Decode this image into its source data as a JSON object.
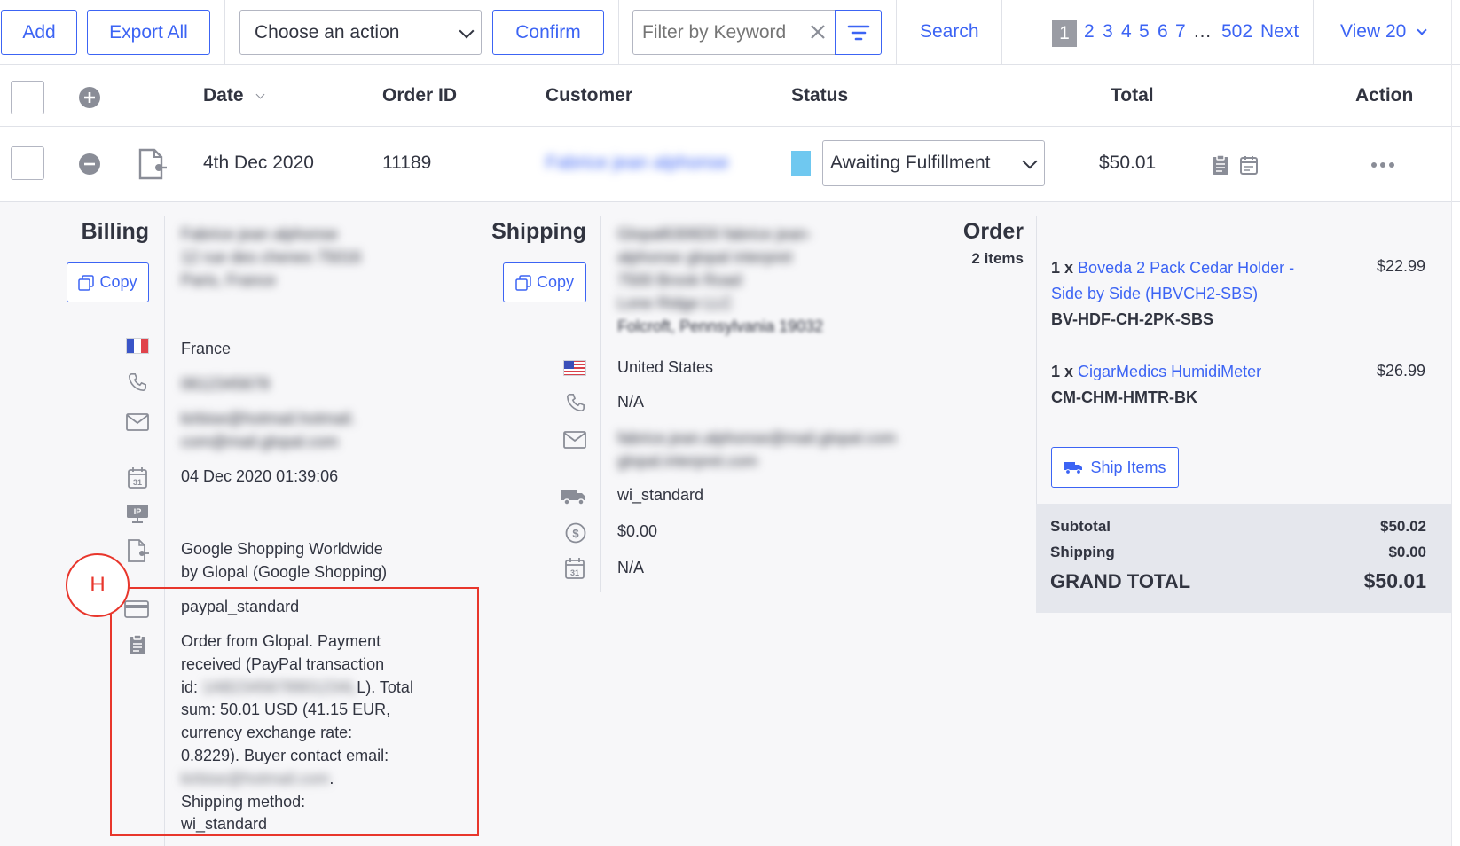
{
  "toolbar": {
    "add_label": "Add",
    "export_label": "Export All",
    "action_select": "Choose an action",
    "confirm_label": "Confirm",
    "filter_placeholder": "Filter by Keyword",
    "search_label": "Search",
    "view_label": "View 20"
  },
  "pagination": {
    "current": "1",
    "pages": [
      "2",
      "3",
      "4",
      "5",
      "6",
      "7"
    ],
    "ellipsis": "…",
    "last": "502",
    "next": "Next"
  },
  "table": {
    "headers": {
      "date": "Date",
      "order_id": "Order ID",
      "customer": "Customer",
      "status": "Status",
      "total": "Total",
      "action": "Action"
    },
    "row": {
      "date": "4th Dec 2020",
      "order_id": "11189",
      "customer": "Fabrice jean alphonse",
      "status": "Awaiting Fulfillment",
      "status_color": "#6fc8f0",
      "total": "$50.01"
    }
  },
  "billing": {
    "title": "Billing",
    "copy_label": "Copy",
    "name": "Fabrice jean alphonse",
    "address_line": "12 rue des chenes 75016",
    "city": "Paris, France",
    "country": "France",
    "phone": "0612345678",
    "email_line1": "kirbise@hotmail.hotmail.",
    "email_line2": "com@mail.glopal.com",
    "date": "04 Dec 2020 01:39:06",
    "source_line1": "Google Shopping Worldwide",
    "source_line2": "by Glopal (Google Shopping)",
    "payment": "paypal_standard",
    "note_lines": [
      "Order from Glopal. Payment",
      "received (PayPal transaction",
      "Total",
      "sum: 50.01 USD (41.15 EUR,",
      "currency exchange rate:",
      "0.8229). Buyer contact email:",
      "Shipping method:",
      "wi_standard"
    ],
    "note_id_prefix": "id:",
    "note_id_blurred": "1AB2345678901234L",
    "note_id_suffix": "L).",
    "note_email_blurred": "kirbise@hotmail.com",
    "note_email_suffix": "."
  },
  "shipping": {
    "title": "Shipping",
    "copy_label": "Copy",
    "line1": "Glopal6306D0 fabrice jean-",
    "line2": "alphonse glopal interpret",
    "line3": "7500 Brook Road",
    "line4": "Lone Ridge LLC",
    "line5": "Folcroft, Pennsylvania 19032",
    "country": "United States",
    "phone": "N/A",
    "email_line1": "fabrice.jean.alphonse@mail.glopal.com",
    "email_line2": "glopal.interpret.com",
    "method": "wi_standard",
    "cost": "$0.00",
    "date": "N/A"
  },
  "order": {
    "title": "Order",
    "items_count": "2 items",
    "items": [
      {
        "qty": "1 x",
        "name_line1": "Boveda 2 Pack Cedar Holder -",
        "name_line2": "Side by Side (HBVCH2-SBS)",
        "sku": "BV-HDF-CH-2PK-SBS",
        "price": "$22.99"
      },
      {
        "qty": "1 x",
        "name_line1": "CigarMedics HumidiMeter",
        "name_line2": "",
        "sku": "CM-CHM-HMTR-BK",
        "price": "$26.99"
      }
    ],
    "ship_label": "Ship Items",
    "subtotal_label": "Subtotal",
    "subtotal": "$50.02",
    "shipping_label": "Shipping",
    "shipping": "$0.00",
    "grand_label": "GRAND TOTAL",
    "grand": "$50.01"
  },
  "annotation": {
    "marker": "H",
    "color": "#e8362c"
  }
}
